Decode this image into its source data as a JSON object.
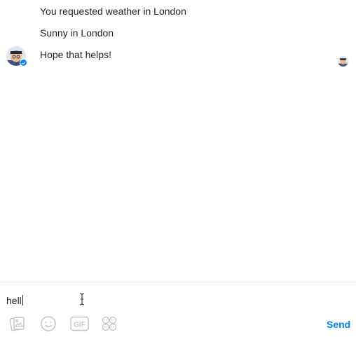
{
  "conversation": {
    "messages": [
      "You requested weather in London",
      "Sunny in London",
      "Hope that helps!"
    ]
  },
  "composer": {
    "input_value": "hell",
    "send_label": "Send",
    "tools": [
      "photo-icon",
      "emoji-icon",
      "gif-icon",
      "stickers-icon"
    ]
  },
  "colors": {
    "accent": "#0084ff",
    "text": "#1d2129",
    "icon": "#bec2c9",
    "divider": "#e6e6e6"
  }
}
